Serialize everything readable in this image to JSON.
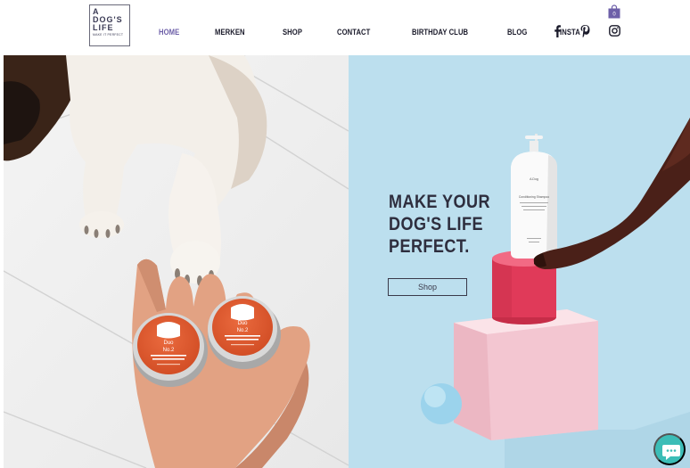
{
  "logo": {
    "line1": "A",
    "line2": "DOG'S",
    "line3": "LIFE",
    "tagline": "MAKE IT PERFECT"
  },
  "nav": {
    "items": [
      {
        "label": "HOME",
        "active": true
      },
      {
        "label": "MERKEN"
      },
      {
        "label": "SHOP"
      },
      {
        "label": "CONTACT"
      },
      {
        "label": "BIRTHDAY CLUB"
      },
      {
        "label": "BLOG"
      },
      {
        "label": "INSTA"
      }
    ]
  },
  "social": {
    "icons": [
      "facebook-icon",
      "pinterest-icon",
      "instagram-icon"
    ]
  },
  "cart": {
    "count": "0",
    "icon": "shopping-bag-icon",
    "color": "#6d5fa8"
  },
  "hero": {
    "headline": [
      "MAKE YOUR",
      "DOG'S LIFE",
      "PERFECT."
    ],
    "cta_label": "Shop",
    "tin1": {
      "brand": "Duo",
      "product": "No.2"
    },
    "tin2": {
      "brand": "Duo",
      "product": "No.2"
    },
    "bottle_brand": "A.Dog",
    "bottle_label": "Conditioning Shampoo"
  },
  "colors": {
    "accent": "#6d5fa8",
    "hero_bg": "#bcdfee",
    "chat": "#3cbdb7",
    "tin": "#e2552b"
  },
  "chat": {
    "icon": "chat-bubble-icon"
  }
}
